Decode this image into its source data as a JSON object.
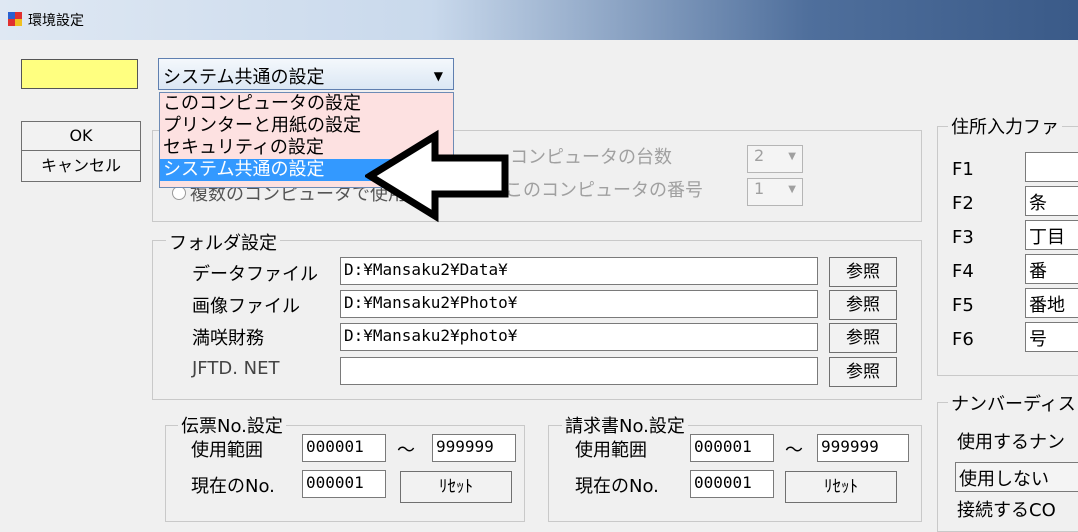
{
  "window": {
    "title": "環境設定"
  },
  "main_buttons": {
    "ok": "OK",
    "cancel": "キャンセル"
  },
  "settings_selector": {
    "selected": "システム共通の設定",
    "options": [
      "このコンピュータの設定",
      "プリンターと用紙の設定",
      "セキュリティの設定",
      "システム共通の設定"
    ]
  },
  "computer_group": {
    "radio_label": "複数のコンピュータで使用",
    "count_label": "コンピュータの台数",
    "count_value": "2",
    "number_label": "このコンピュータの番号",
    "number_value": "1"
  },
  "folder_settings": {
    "legend": "フォルダ設定",
    "browse_label": "参照",
    "rows": [
      {
        "label": "データファイル",
        "value": "D:¥Mansaku2¥Data¥"
      },
      {
        "label": "画像ファイル",
        "value": "D:¥Mansaku2¥Photo¥"
      },
      {
        "label": "満咲財務",
        "value": "D:¥Mansaku2¥photo¥"
      },
      {
        "label": "JFTD. NET",
        "value": ""
      }
    ]
  },
  "voucher_settings": {
    "legend": "伝票No.設定",
    "range_label": "使用範囲",
    "range_from": "000001",
    "tilde": "～",
    "range_to": "999999",
    "current_label": "現在のNo.",
    "current_value": "000001",
    "reset_label": "ﾘｾｯﾄ"
  },
  "invoice_settings": {
    "legend": "請求書No.設定",
    "range_label": "使用範囲",
    "range_from": "000001",
    "tilde": "～",
    "range_to": "999999",
    "current_label": "現在のNo.",
    "current_value": "000001",
    "reset_label": "ﾘｾｯﾄ"
  },
  "address_input": {
    "legend": "住所入力ファ",
    "keys": [
      {
        "key": "F1",
        "value": ""
      },
      {
        "key": "F2",
        "value": "条"
      },
      {
        "key": "F3",
        "value": "丁目"
      },
      {
        "key": "F4",
        "value": "番"
      },
      {
        "key": "F5",
        "value": "番地"
      },
      {
        "key": "F6",
        "value": "号"
      }
    ]
  },
  "number_display": {
    "legend": "ナンバーディス",
    "use_label": "使用するナン",
    "use_value": "使用しない",
    "connect_label": "接続するCO"
  },
  "colors": {
    "highlight": "#3399ff",
    "dropdown_bg": "#fde1e1",
    "swatch": "#ffff80"
  }
}
